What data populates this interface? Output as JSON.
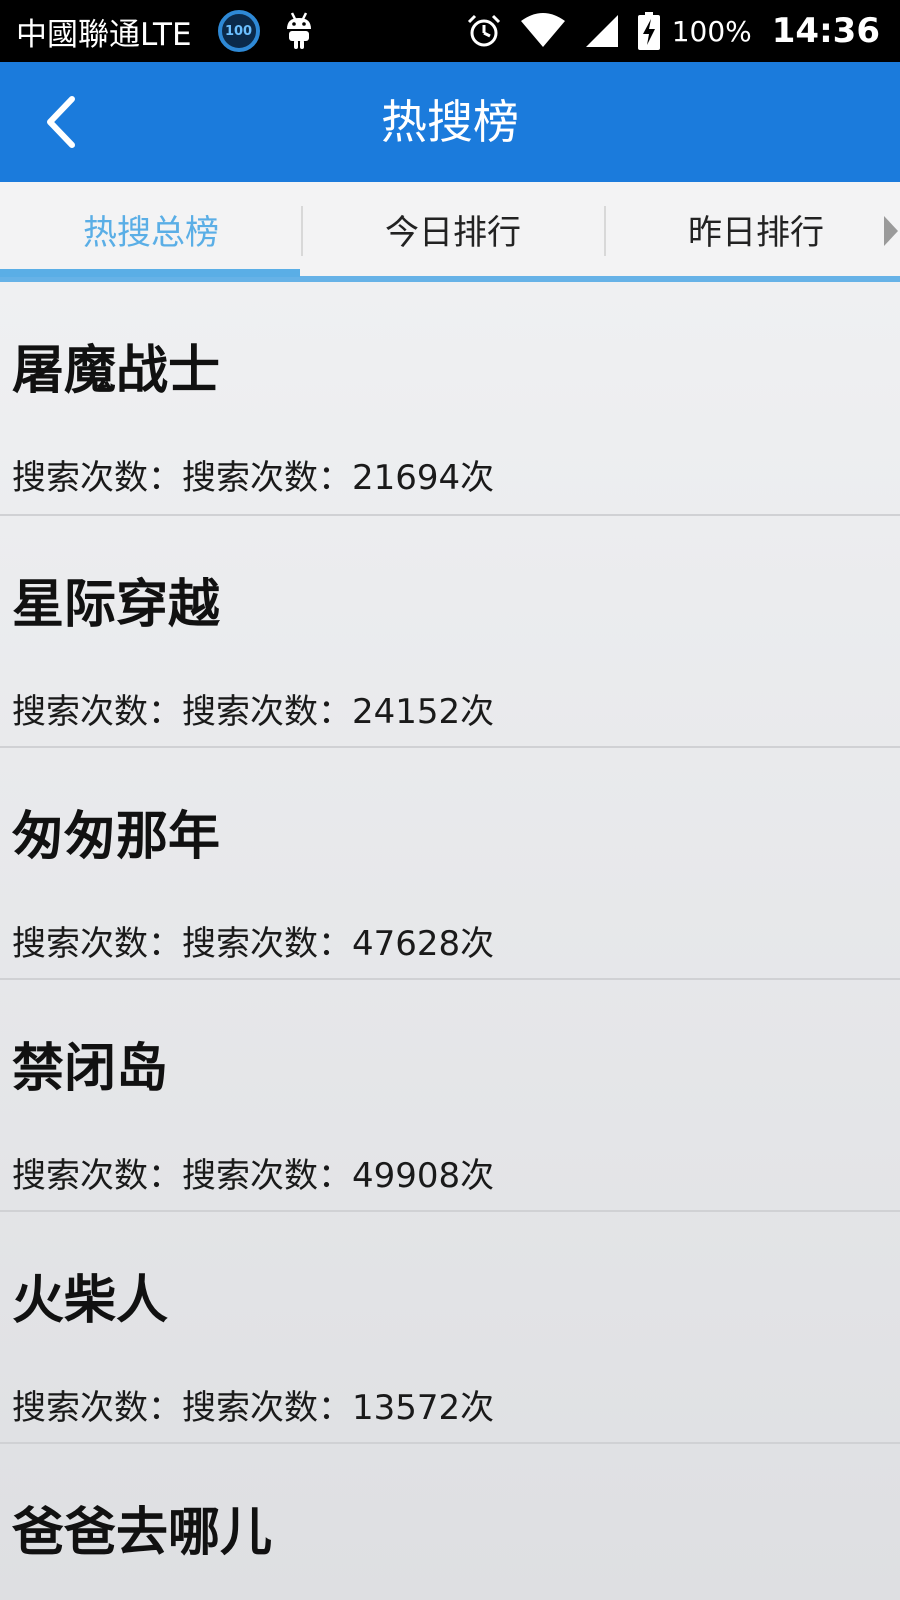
{
  "status_bar": {
    "carrier": "中國聯通LTE",
    "badge": "100",
    "battery": "100%",
    "time": "14:36",
    "icons": [
      "badge-100-icon",
      "android-icon",
      "alarm-icon",
      "wifi-icon",
      "signal-icon",
      "battery-charging-icon"
    ]
  },
  "header": {
    "title": "热搜榜",
    "back_icon": "chevron-left-icon"
  },
  "tabs": [
    {
      "label": "热搜总榜",
      "active": true
    },
    {
      "label": "今日排行",
      "active": false
    },
    {
      "label": "昨日排行",
      "active": false
    }
  ],
  "list": {
    "items": [
      {
        "title": "屠魔战士",
        "count": "搜索次数：搜索次数：21694次"
      },
      {
        "title": "星际穿越",
        "count": "搜索次数：搜索次数：24152次"
      },
      {
        "title": "匆匆那年",
        "count": "搜索次数：搜索次数：47628次"
      },
      {
        "title": "禁闭岛",
        "count": "搜索次数：搜索次数：49908次"
      },
      {
        "title": "火柴人",
        "count": "搜索次数：搜索次数：13572次"
      },
      {
        "title": "爸爸去哪儿",
        "count": ""
      }
    ]
  },
  "colors": {
    "header_bg": "#1b7bdc",
    "tab_active": "#5aaee6",
    "status_bg": "#000000"
  }
}
